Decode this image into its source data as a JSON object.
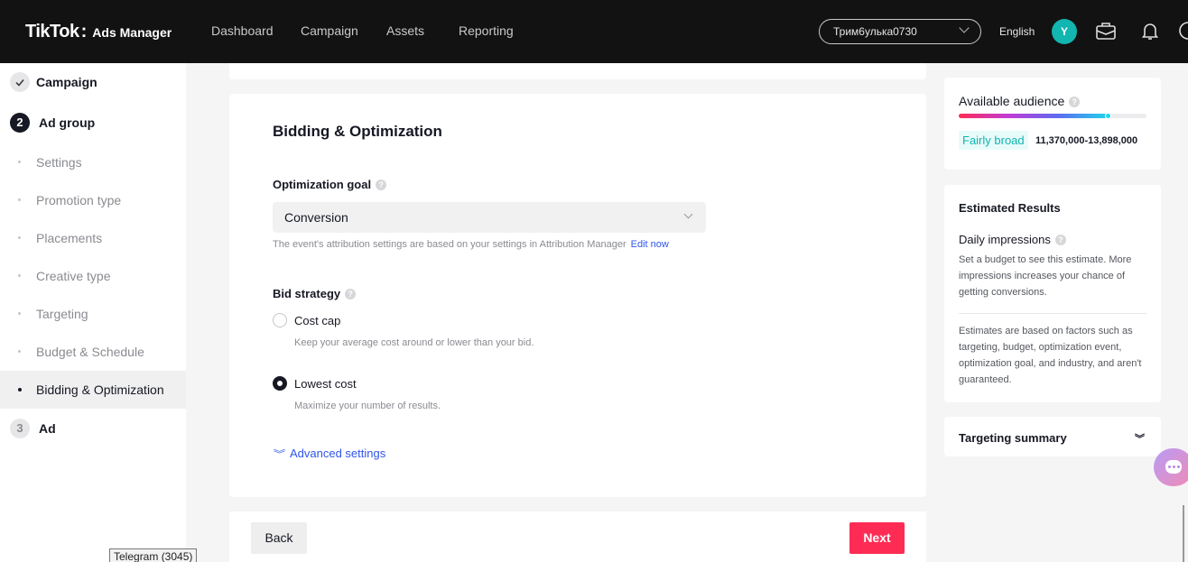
{
  "header": {
    "brand": "TikTok",
    "colon": ":",
    "product": "Ads Manager",
    "nav": [
      "Dashboard",
      "Campaign",
      "Assets",
      "Reporting"
    ],
    "account": "Трим6улька0730",
    "language": "English",
    "avatar_letter": "Y"
  },
  "sidebar": {
    "steps": [
      {
        "label": "Campaign",
        "state": "done"
      },
      {
        "number": "2",
        "label": "Ad group",
        "state": "active"
      },
      {
        "number": "3",
        "label": "Ad",
        "state": "future"
      }
    ],
    "subitems": [
      "Settings",
      "Promotion type",
      "Placements",
      "Creative type",
      "Targeting",
      "Budget & Schedule",
      "Bidding & Optimization"
    ],
    "active_subitem": "Bidding & Optimization"
  },
  "main": {
    "title": "Bidding & Optimization",
    "optimization_goal_label": "Optimization goal",
    "optimization_goal_value": "Conversion",
    "attribution_note": "The event's attribution settings are based on your settings in Attribution Manager",
    "edit_link": "Edit now",
    "bid_strategy_label": "Bid strategy",
    "options": [
      {
        "label": "Cost cap",
        "desc": "Keep your average cost around or lower than your bid.",
        "checked": false
      },
      {
        "label": "Lowest cost",
        "desc": "Maximize your number of results.",
        "checked": true
      }
    ],
    "advanced_settings": "Advanced settings"
  },
  "footer": {
    "back": "Back",
    "next": "Next"
  },
  "right": {
    "audience_title": "Available audience",
    "audience_level": 0.8,
    "audience_tag": "Fairly broad",
    "audience_range": "11,370,000-13,898,000",
    "estimated_title": "Estimated Results",
    "daily_impressions": "Daily impressions",
    "impressions_text": "Set a budget to see this estimate. More impressions increases your chance of getting conversions.",
    "disclaimer": "Estimates are based on factors such as targeting, budget, optimization event, optimization goal, and industry, and aren't guaranteed.",
    "targeting_summary": "Targeting summary"
  },
  "taskbar_tooltip": "Telegram (3045)",
  "colors": {
    "accent_red": "#fe2c55",
    "teal": "#12b5b0",
    "link_blue": "#2f54eb"
  }
}
